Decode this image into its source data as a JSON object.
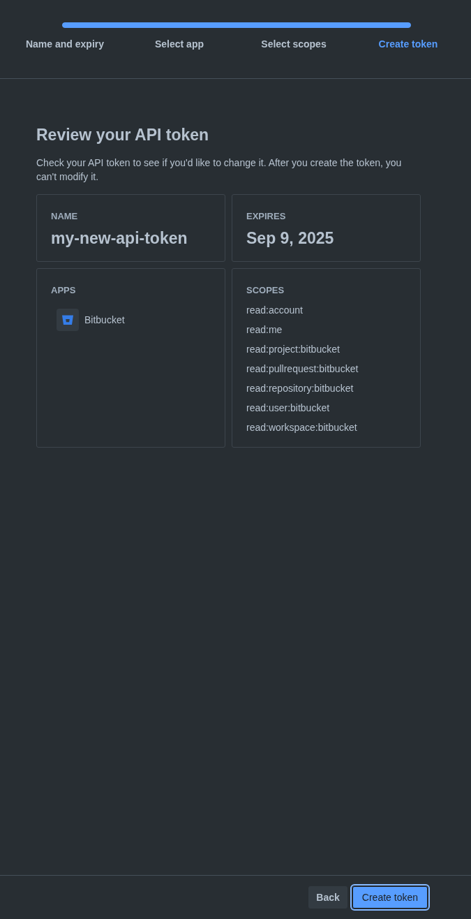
{
  "progress": {
    "level": 1
  },
  "steps": [
    {
      "label": "Name and expiry",
      "selected": false
    },
    {
      "label": "Select app",
      "selected": false
    },
    {
      "label": "Select scopes",
      "selected": false
    },
    {
      "label": "Create token",
      "selected": true
    }
  ],
  "review": {
    "title": "Review your API token",
    "description": "Check your API token to see if you'd like to change it. After you create the token, you can't modify it.",
    "cards": [
      {
        "kind": "value",
        "label": "NAME",
        "value": "my-new-api-token"
      },
      {
        "kind": "value",
        "label": "EXPIRES",
        "value": "Sep 9, 2025"
      },
      {
        "kind": "apps",
        "label": "APPS",
        "apps": [
          {
            "name": "Bitbucket"
          }
        ]
      },
      {
        "kind": "list",
        "label": "SCOPES",
        "items": [
          "read:account",
          "read:me",
          "read:project:bitbucket",
          "read:pullrequest:bitbucket",
          "read:repository:bitbucket",
          "read:user:bitbucket",
          "read:workspace:bitbucket"
        ]
      }
    ]
  },
  "footer": {
    "buttons": [
      {
        "label": "Back",
        "kind": "secondary",
        "focused": false
      },
      {
        "label": "Create token",
        "kind": "primary",
        "focused": true
      }
    ]
  }
}
